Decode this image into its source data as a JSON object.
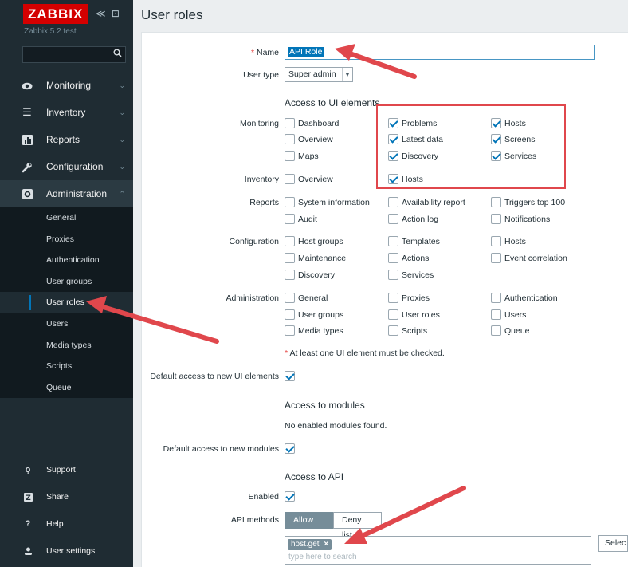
{
  "sidebar": {
    "brand": "ZABBIX",
    "brand_controls": "≪ ⊡",
    "server_name": "Zabbix 5.2 test",
    "search_icon": "search-icon",
    "menu": [
      {
        "label": "Monitoring",
        "icon": "eye-icon"
      },
      {
        "label": "Inventory",
        "icon": "list-icon"
      },
      {
        "label": "Reports",
        "icon": "bar-chart-icon"
      },
      {
        "label": "Configuration",
        "icon": "wrench-icon"
      },
      {
        "label": "Administration",
        "icon": "gear-icon"
      }
    ],
    "admin_submenu": [
      "General",
      "Proxies",
      "Authentication",
      "User groups",
      "User roles",
      "Users",
      "Media types",
      "Scripts",
      "Queue"
    ],
    "footer": [
      {
        "label": "Support",
        "icon": "headset-icon"
      },
      {
        "label": "Share",
        "icon": "share-icon"
      },
      {
        "label": "Help",
        "icon": "help-icon"
      },
      {
        "label": "User settings",
        "icon": "user-icon"
      }
    ]
  },
  "page": {
    "title": "User roles"
  },
  "form": {
    "name_label": "Name",
    "name_required": "*",
    "name_value": "API Role",
    "user_type_label": "User type",
    "user_type_value": "Super admin",
    "access_ui_heading": "Access to UI elements",
    "groups": {
      "monitoring": {
        "label": "Monitoring",
        "items": [
          {
            "label": "Dashboard",
            "checked": false
          },
          {
            "label": "Problems",
            "checked": true
          },
          {
            "label": "Hosts",
            "checked": true
          },
          {
            "label": "Overview",
            "checked": false
          },
          {
            "label": "Latest data",
            "checked": true
          },
          {
            "label": "Screens",
            "checked": true
          },
          {
            "label": "Maps",
            "checked": false
          },
          {
            "label": "Discovery",
            "checked": true
          },
          {
            "label": "Services",
            "checked": true
          }
        ]
      },
      "inventory": {
        "label": "Inventory",
        "items": [
          {
            "label": "Overview",
            "checked": false
          },
          {
            "label": "Hosts",
            "checked": true
          }
        ]
      },
      "reports": {
        "label": "Reports",
        "items": [
          {
            "label": "System information",
            "checked": false
          },
          {
            "label": "Availability report",
            "checked": false
          },
          {
            "label": "Triggers top 100",
            "checked": false
          },
          {
            "label": "Audit",
            "checked": false
          },
          {
            "label": "Action log",
            "checked": false
          },
          {
            "label": "Notifications",
            "checked": false
          }
        ]
      },
      "configuration": {
        "label": "Configuration",
        "items": [
          {
            "label": "Host groups",
            "checked": false
          },
          {
            "label": "Templates",
            "checked": false
          },
          {
            "label": "Hosts",
            "checked": false
          },
          {
            "label": "Maintenance",
            "checked": false
          },
          {
            "label": "Actions",
            "checked": false
          },
          {
            "label": "Event correlation",
            "checked": false
          },
          {
            "label": "Discovery",
            "checked": false
          },
          {
            "label": "Services",
            "checked": false
          }
        ]
      },
      "administration": {
        "label": "Administration",
        "items": [
          {
            "label": "General",
            "checked": false
          },
          {
            "label": "Proxies",
            "checked": false
          },
          {
            "label": "Authentication",
            "checked": false
          },
          {
            "label": "User groups",
            "checked": false
          },
          {
            "label": "User roles",
            "checked": false
          },
          {
            "label": "Users",
            "checked": false
          },
          {
            "label": "Media types",
            "checked": false
          },
          {
            "label": "Scripts",
            "checked": false
          },
          {
            "label": "Queue",
            "checked": false
          }
        ]
      }
    },
    "ui_note": "At least one UI element must be checked.",
    "ui_note_star": "*",
    "default_ui_label": "Default access to new UI elements",
    "default_ui_checked": true,
    "modules_heading": "Access to modules",
    "modules_note": "No enabled modules found.",
    "default_modules_label": "Default access to new modules",
    "default_modules_checked": true,
    "api_heading": "Access to API",
    "enabled_label": "Enabled",
    "enabled_checked": true,
    "api_methods_label": "API methods",
    "allow_list": "Allow list",
    "deny_list": "Deny list",
    "api_tag": "host.get",
    "api_tag_remove": "×",
    "api_placeholder": "type here to search",
    "select_button": "Selec"
  },
  "colors": {
    "sidebar_bg": "#1f2c33",
    "brand_red": "#d40000",
    "accent_blue": "#0275b8",
    "annotation_red": "#e0474c"
  }
}
